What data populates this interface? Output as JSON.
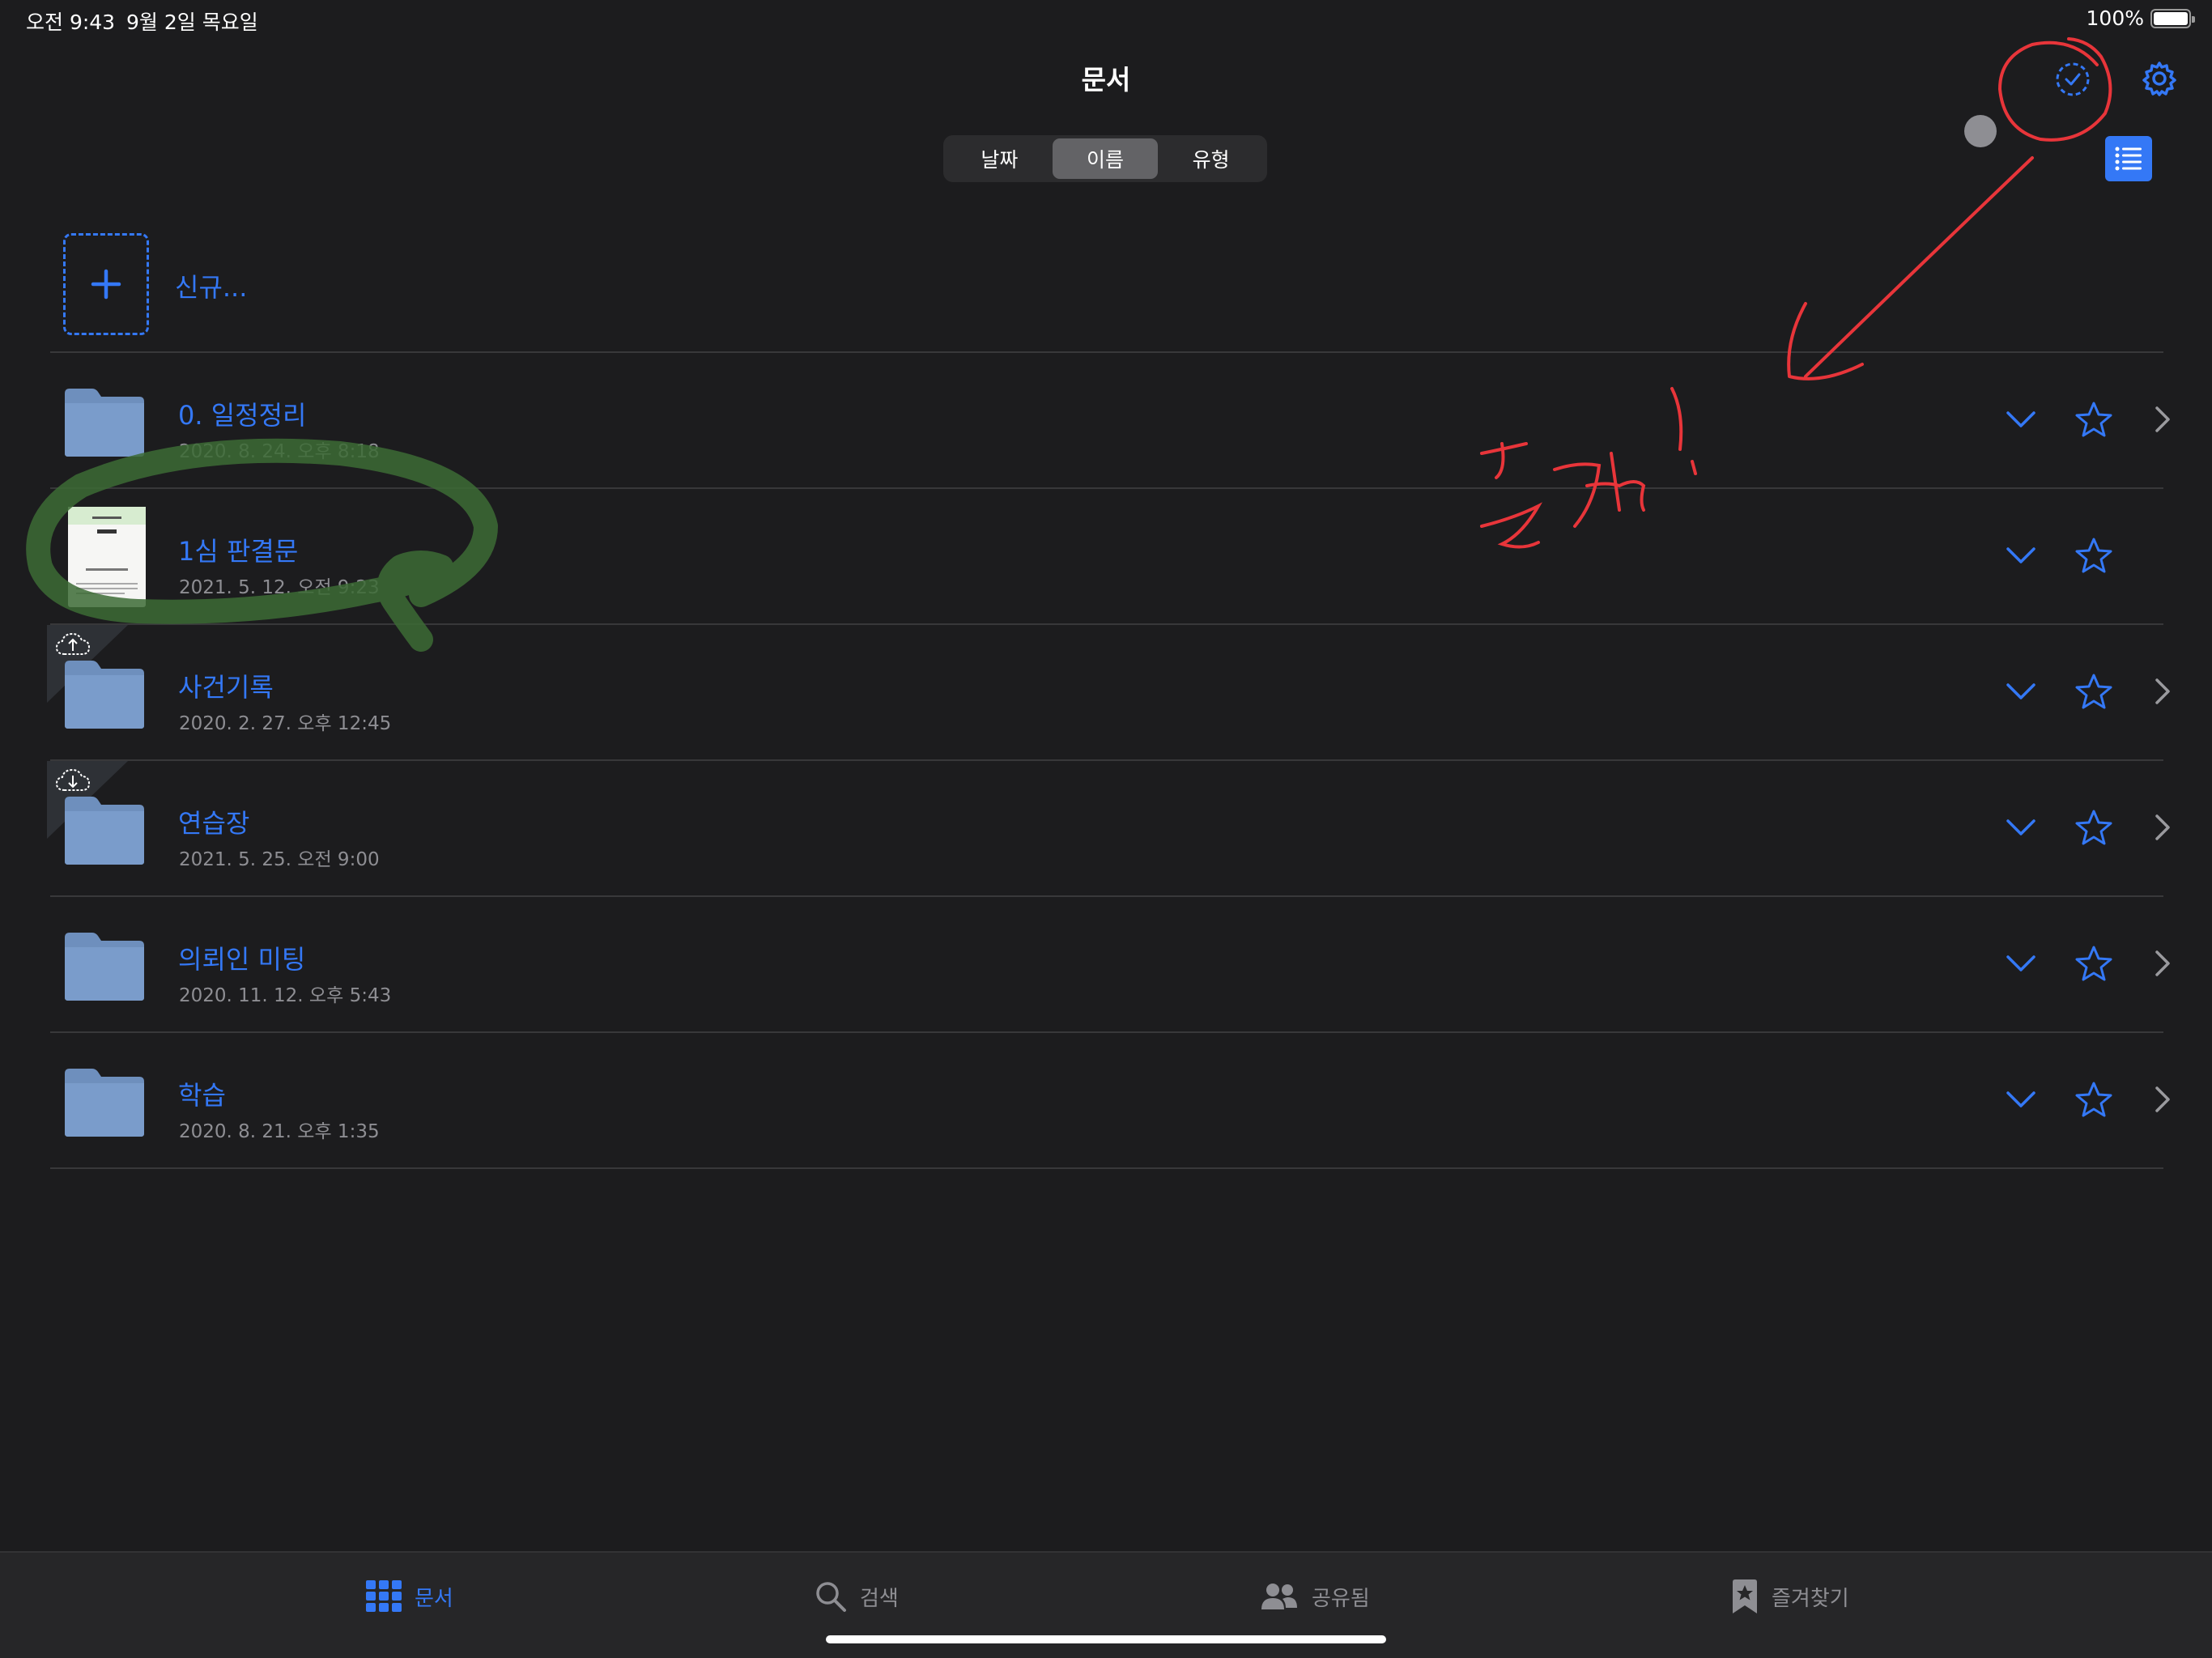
{
  "status_bar": {
    "time": "오전 9:43",
    "date": "9월 2일 목요일",
    "battery": "100%"
  },
  "header": {
    "title": "문서",
    "select_icon": "checkmark-circle-dashed-icon",
    "settings_icon": "gear-icon",
    "view_icon": "list-view-icon"
  },
  "sort": {
    "options": [
      "날짜",
      "이름",
      "유형"
    ],
    "selected": "이름"
  },
  "new_item": {
    "label": "신규..."
  },
  "rows": [
    {
      "title": "0. 일정정리",
      "date": "2020. 8. 24. 오후 8:18",
      "type": "folder"
    },
    {
      "title": "1심 판결문",
      "date": "2021. 5. 12. 오전 9:23",
      "type": "document"
    },
    {
      "title": "사건기록",
      "date": "2020. 2. 27. 오후 12:45",
      "type": "folder",
      "badge": "cloud-upload-icon"
    },
    {
      "title": "연습장",
      "date": "2021. 5. 25. 오전 9:00",
      "type": "folder",
      "badge": "cloud-download-icon"
    },
    {
      "title": "의뢰인 미팅",
      "date": "2020. 11. 12. 오후 5:43",
      "type": "folder"
    },
    {
      "title": "학습",
      "date": "2020. 8. 21. 오후 1:35",
      "type": "folder"
    }
  ],
  "tabs": [
    {
      "label": "문서",
      "icon": "grid-icon",
      "active": true
    },
    {
      "label": "검색",
      "icon": "search-icon",
      "active": false
    },
    {
      "label": "공유됨",
      "icon": "people-icon",
      "active": false
    },
    {
      "label": "즐겨찾기",
      "icon": "bookmark-star-icon",
      "active": false
    }
  ],
  "colors": {
    "accent": "#3478f6",
    "background": "#1c1c1e",
    "annotation_red": "#e8353a",
    "annotation_green": "#3c6b35"
  }
}
